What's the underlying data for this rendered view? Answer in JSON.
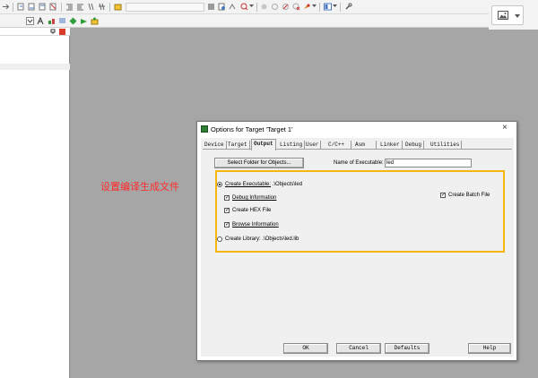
{
  "annotation": {
    "text": "设置编译生成文件",
    "color": "#ff2a2a",
    "arrow_color": "#ff3b1f"
  },
  "dialog": {
    "title": "Options for Target 'Target 1'",
    "close_glyph": "×",
    "tabs": [
      "Device",
      "Target",
      "Output",
      "Listing",
      "User",
      "C/C++",
      "Asm",
      "Linker",
      "Debug",
      "Utilities"
    ],
    "active_tab": "Output",
    "select_folder_label": "Select Folder for Objects...",
    "name_of_executable_label": "Name of Executable:",
    "name_of_executable_value": "led",
    "create_executable_label": "Create Executable:",
    "create_executable_path": ".\\Objects\\led",
    "debug_information_label": "Debug Information",
    "create_hex_label": "Create HEX File",
    "browse_information_label": "Browse Information",
    "create_library_label": "Create Library:",
    "create_library_path": ".\\Objects\\led.lib",
    "create_batch_label": "Create Batch File",
    "buttons": {
      "ok": "OK",
      "cancel": "Cancel",
      "defaults": "Defaults",
      "help": "Help"
    },
    "highlight_color": "#f6b60c"
  },
  "state": {
    "create_executable": true,
    "debug_information": true,
    "create_hex": true,
    "browse_information": true,
    "create_library": false,
    "create_batch": true
  },
  "checkmark_glyph": "✓"
}
